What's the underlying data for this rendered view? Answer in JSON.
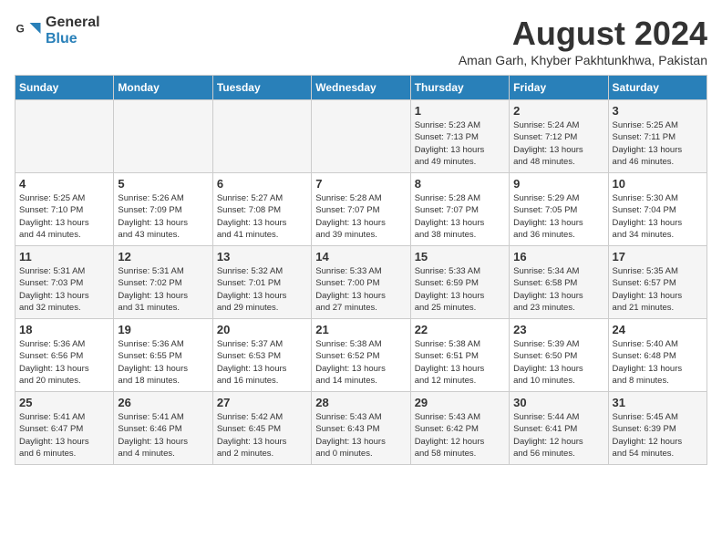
{
  "logo": {
    "text_general": "General",
    "text_blue": "Blue"
  },
  "title": "August 2024",
  "subtitle": "Aman Garh, Khyber Pakhtunkhwa, Pakistan",
  "days_of_week": [
    "Sunday",
    "Monday",
    "Tuesday",
    "Wednesday",
    "Thursday",
    "Friday",
    "Saturday"
  ],
  "weeks": [
    [
      {
        "day": "",
        "info": ""
      },
      {
        "day": "",
        "info": ""
      },
      {
        "day": "",
        "info": ""
      },
      {
        "day": "",
        "info": ""
      },
      {
        "day": "1",
        "info": "Sunrise: 5:23 AM\nSunset: 7:13 PM\nDaylight: 13 hours\nand 49 minutes."
      },
      {
        "day": "2",
        "info": "Sunrise: 5:24 AM\nSunset: 7:12 PM\nDaylight: 13 hours\nand 48 minutes."
      },
      {
        "day": "3",
        "info": "Sunrise: 5:25 AM\nSunset: 7:11 PM\nDaylight: 13 hours\nand 46 minutes."
      }
    ],
    [
      {
        "day": "4",
        "info": "Sunrise: 5:25 AM\nSunset: 7:10 PM\nDaylight: 13 hours\nand 44 minutes."
      },
      {
        "day": "5",
        "info": "Sunrise: 5:26 AM\nSunset: 7:09 PM\nDaylight: 13 hours\nand 43 minutes."
      },
      {
        "day": "6",
        "info": "Sunrise: 5:27 AM\nSunset: 7:08 PM\nDaylight: 13 hours\nand 41 minutes."
      },
      {
        "day": "7",
        "info": "Sunrise: 5:28 AM\nSunset: 7:07 PM\nDaylight: 13 hours\nand 39 minutes."
      },
      {
        "day": "8",
        "info": "Sunrise: 5:28 AM\nSunset: 7:07 PM\nDaylight: 13 hours\nand 38 minutes."
      },
      {
        "day": "9",
        "info": "Sunrise: 5:29 AM\nSunset: 7:05 PM\nDaylight: 13 hours\nand 36 minutes."
      },
      {
        "day": "10",
        "info": "Sunrise: 5:30 AM\nSunset: 7:04 PM\nDaylight: 13 hours\nand 34 minutes."
      }
    ],
    [
      {
        "day": "11",
        "info": "Sunrise: 5:31 AM\nSunset: 7:03 PM\nDaylight: 13 hours\nand 32 minutes."
      },
      {
        "day": "12",
        "info": "Sunrise: 5:31 AM\nSunset: 7:02 PM\nDaylight: 13 hours\nand 31 minutes."
      },
      {
        "day": "13",
        "info": "Sunrise: 5:32 AM\nSunset: 7:01 PM\nDaylight: 13 hours\nand 29 minutes."
      },
      {
        "day": "14",
        "info": "Sunrise: 5:33 AM\nSunset: 7:00 PM\nDaylight: 13 hours\nand 27 minutes."
      },
      {
        "day": "15",
        "info": "Sunrise: 5:33 AM\nSunset: 6:59 PM\nDaylight: 13 hours\nand 25 minutes."
      },
      {
        "day": "16",
        "info": "Sunrise: 5:34 AM\nSunset: 6:58 PM\nDaylight: 13 hours\nand 23 minutes."
      },
      {
        "day": "17",
        "info": "Sunrise: 5:35 AM\nSunset: 6:57 PM\nDaylight: 13 hours\nand 21 minutes."
      }
    ],
    [
      {
        "day": "18",
        "info": "Sunrise: 5:36 AM\nSunset: 6:56 PM\nDaylight: 13 hours\nand 20 minutes."
      },
      {
        "day": "19",
        "info": "Sunrise: 5:36 AM\nSunset: 6:55 PM\nDaylight: 13 hours\nand 18 minutes."
      },
      {
        "day": "20",
        "info": "Sunrise: 5:37 AM\nSunset: 6:53 PM\nDaylight: 13 hours\nand 16 minutes."
      },
      {
        "day": "21",
        "info": "Sunrise: 5:38 AM\nSunset: 6:52 PM\nDaylight: 13 hours\nand 14 minutes."
      },
      {
        "day": "22",
        "info": "Sunrise: 5:38 AM\nSunset: 6:51 PM\nDaylight: 13 hours\nand 12 minutes."
      },
      {
        "day": "23",
        "info": "Sunrise: 5:39 AM\nSunset: 6:50 PM\nDaylight: 13 hours\nand 10 minutes."
      },
      {
        "day": "24",
        "info": "Sunrise: 5:40 AM\nSunset: 6:48 PM\nDaylight: 13 hours\nand 8 minutes."
      }
    ],
    [
      {
        "day": "25",
        "info": "Sunrise: 5:41 AM\nSunset: 6:47 PM\nDaylight: 13 hours\nand 6 minutes."
      },
      {
        "day": "26",
        "info": "Sunrise: 5:41 AM\nSunset: 6:46 PM\nDaylight: 13 hours\nand 4 minutes."
      },
      {
        "day": "27",
        "info": "Sunrise: 5:42 AM\nSunset: 6:45 PM\nDaylight: 13 hours\nand 2 minutes."
      },
      {
        "day": "28",
        "info": "Sunrise: 5:43 AM\nSunset: 6:43 PM\nDaylight: 13 hours\nand 0 minutes."
      },
      {
        "day": "29",
        "info": "Sunrise: 5:43 AM\nSunset: 6:42 PM\nDaylight: 12 hours\nand 58 minutes."
      },
      {
        "day": "30",
        "info": "Sunrise: 5:44 AM\nSunset: 6:41 PM\nDaylight: 12 hours\nand 56 minutes."
      },
      {
        "day": "31",
        "info": "Sunrise: 5:45 AM\nSunset: 6:39 PM\nDaylight: 12 hours\nand 54 minutes."
      }
    ]
  ]
}
